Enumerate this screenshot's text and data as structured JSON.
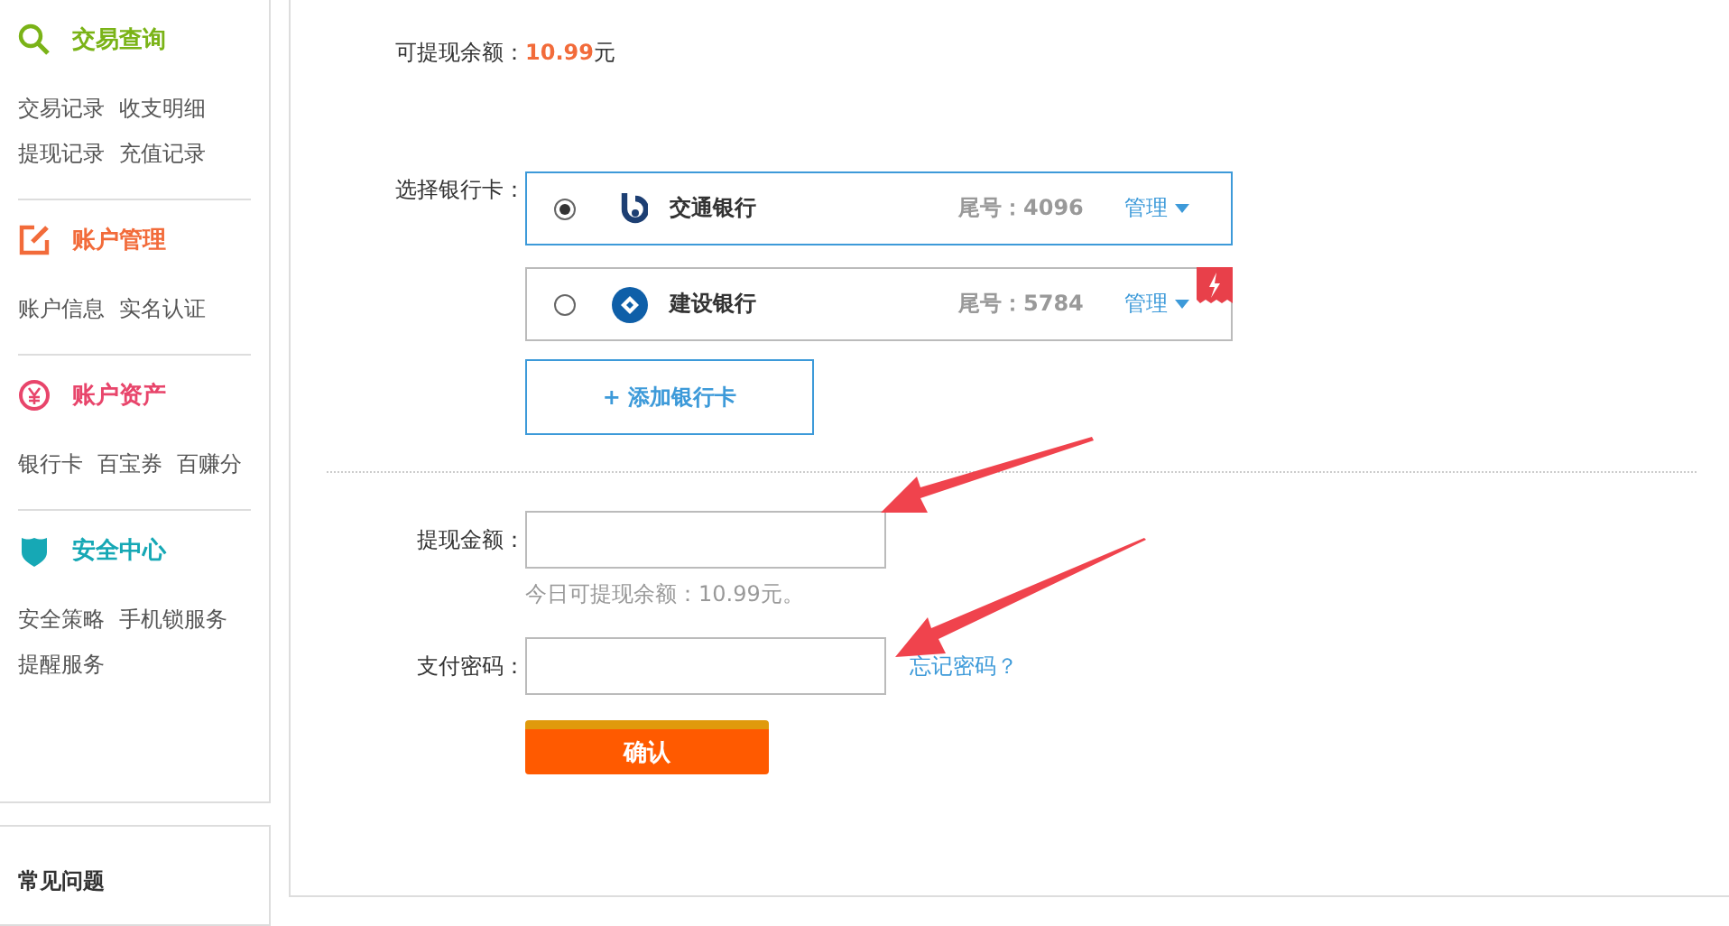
{
  "sidebar": {
    "sections": [
      {
        "kind": "search",
        "title": "交易查询",
        "color": "#7ab317",
        "links": [
          [
            "交易记录",
            "收支明细"
          ],
          [
            "提现记录",
            "充值记录"
          ]
        ]
      },
      {
        "kind": "edit",
        "title": "账户管理",
        "color": "#f26b3a",
        "links": [
          [
            "账户信息",
            "实名认证"
          ]
        ]
      },
      {
        "kind": "yuan",
        "title": "账户资产",
        "color": "#e8456b",
        "links": [
          [
            "银行卡",
            "百宝券",
            "百赚分"
          ]
        ]
      },
      {
        "kind": "shield",
        "title": "安全中心",
        "color": "#16a8b5",
        "links": [
          [
            "安全策略",
            "手机锁服务"
          ],
          [
            "提醒服务"
          ]
        ]
      }
    ],
    "faq_title": "常见问题"
  },
  "balance": {
    "label": "可提现余额：",
    "amount": "10.99",
    "unit": "元"
  },
  "bank_select": {
    "label": "选择银行卡：",
    "cards": [
      {
        "kind": "bocom",
        "name": "交通银行",
        "tail": "尾号：4096",
        "manage": "管理",
        "selected": true,
        "flash": false
      },
      {
        "kind": "ccb",
        "name": "建设银行",
        "tail": "尾号：5784",
        "manage": "管理",
        "selected": false,
        "flash": true
      }
    ],
    "add_button": "+ 添加银行卡"
  },
  "amount": {
    "label": "提现金额：",
    "hint": "今日可提现余额：10.99元。"
  },
  "password": {
    "label": "支付密码：",
    "forgot_link": "忘记密码？"
  },
  "confirm_button": "确认"
}
